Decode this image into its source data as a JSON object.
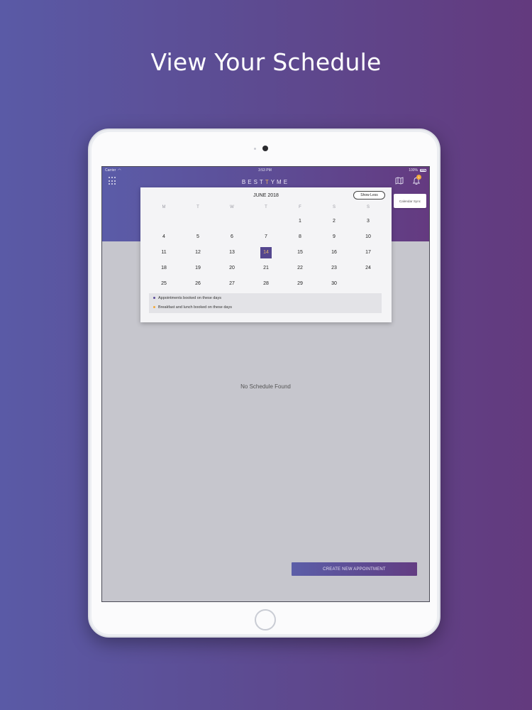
{
  "headline": "View Your Schedule",
  "status_bar": {
    "carrier": "Carrier",
    "time": "3:53 PM",
    "battery": "100%"
  },
  "app": {
    "logo_part1": "BEST",
    "logo_part2": "YME",
    "logo_accent": "T",
    "notification_count": "1",
    "calendar_sync_label": "Calendar Sync",
    "empty_message": "No Schedule Found",
    "create_button_label": "CREATE NEW APPOINTMENT"
  },
  "calendar": {
    "month_label": "JUNE 2018",
    "toggle_label": "Show Less",
    "weekdays": [
      "M",
      "T",
      "W",
      "T",
      "F",
      "S",
      "S"
    ],
    "weeks": [
      [
        "",
        "",
        "",
        "",
        "1",
        "2",
        "3"
      ],
      [
        "4",
        "5",
        "6",
        "7",
        "8",
        "9",
        "10"
      ],
      [
        "11",
        "12",
        "13",
        "14",
        "15",
        "16",
        "17"
      ],
      [
        "18",
        "19",
        "20",
        "21",
        "22",
        "23",
        "24"
      ],
      [
        "25",
        "26",
        "27",
        "28",
        "29",
        "30",
        ""
      ]
    ],
    "selected_day": "14",
    "legend": [
      {
        "label": "Appointments booked on these days",
        "color": "#5b4a9a"
      },
      {
        "label": "Breakfast and lunch booked on these days",
        "color": "#f2a93b"
      }
    ]
  },
  "colors": {
    "accent_purple": "#54468e",
    "accent_gold": "#e2b36a"
  }
}
